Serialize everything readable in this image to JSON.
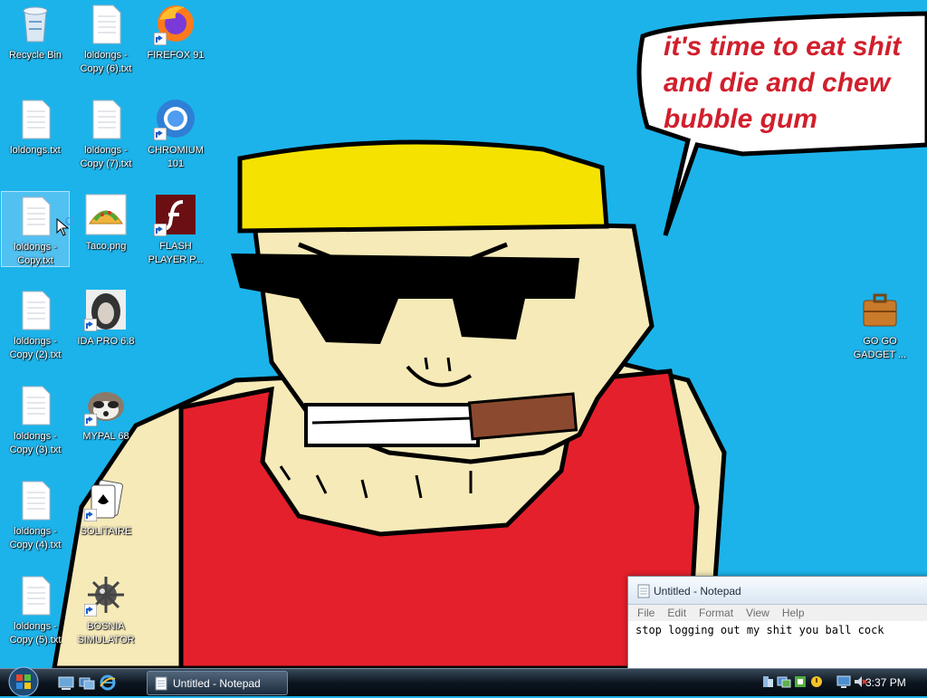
{
  "desktop": {
    "speech_bubble_text": [
      "it's time to eat shit",
      "and die and chew",
      "bubble gum"
    ],
    "icons": [
      {
        "label": "Recycle Bin",
        "icon": "recycle-bin-icon"
      },
      {
        "label": "loldongs - Copy (6).txt",
        "icon": "text-file-icon"
      },
      {
        "label": "FIREFOX 91",
        "icon": "firefox-icon"
      },
      {
        "label": "loldongs.txt",
        "icon": "text-file-icon"
      },
      {
        "label": "loldongs - Copy (7).txt",
        "icon": "text-file-icon"
      },
      {
        "label": "CHROMIUM 101",
        "icon": "chromium-icon"
      },
      {
        "label": "loldongs - Copy.txt",
        "icon": "text-file-icon"
      },
      {
        "label": "Taco.png",
        "icon": "taco-image-icon"
      },
      {
        "label": "FLASH PLAYER P...",
        "icon": "flash-player-icon"
      },
      {
        "label": "loldongs - Copy (2).txt",
        "icon": "text-file-icon"
      },
      {
        "label": "IDA PRO 6.8",
        "icon": "ida-pro-icon"
      },
      {
        "label": "loldongs - Copy (3).txt",
        "icon": "text-file-icon"
      },
      {
        "label": "MYPAL 68",
        "icon": "raccoon-icon"
      },
      {
        "label": "loldongs - Copy (4).txt",
        "icon": "text-file-icon"
      },
      {
        "label": "SOLITAIRE",
        "icon": "cards-icon"
      },
      {
        "label": "loldongs - Copy (5).txt",
        "icon": "text-file-icon"
      },
      {
        "label": "BOSNIA SIMULATOR",
        "icon": "mine-icon"
      },
      {
        "label": "GO GO GADGET ...",
        "icon": "briefcase-icon"
      }
    ]
  },
  "notepad": {
    "title": "Untitled - Notepad",
    "menu": [
      "File",
      "Edit",
      "Format",
      "View",
      "Help"
    ],
    "content": "stop logging out my shit you ball cock"
  },
  "taskbar": {
    "task_label": "Untitled - Notepad",
    "clock": "3:37 PM"
  },
  "colors": {
    "desktop_bg": "#1cb3ea",
    "shirt": "#e4202c",
    "hair": "#f5e200",
    "skin": "#f6eab8",
    "cigar": "#8b4a2f",
    "bubble_text": "#d11f2c"
  }
}
